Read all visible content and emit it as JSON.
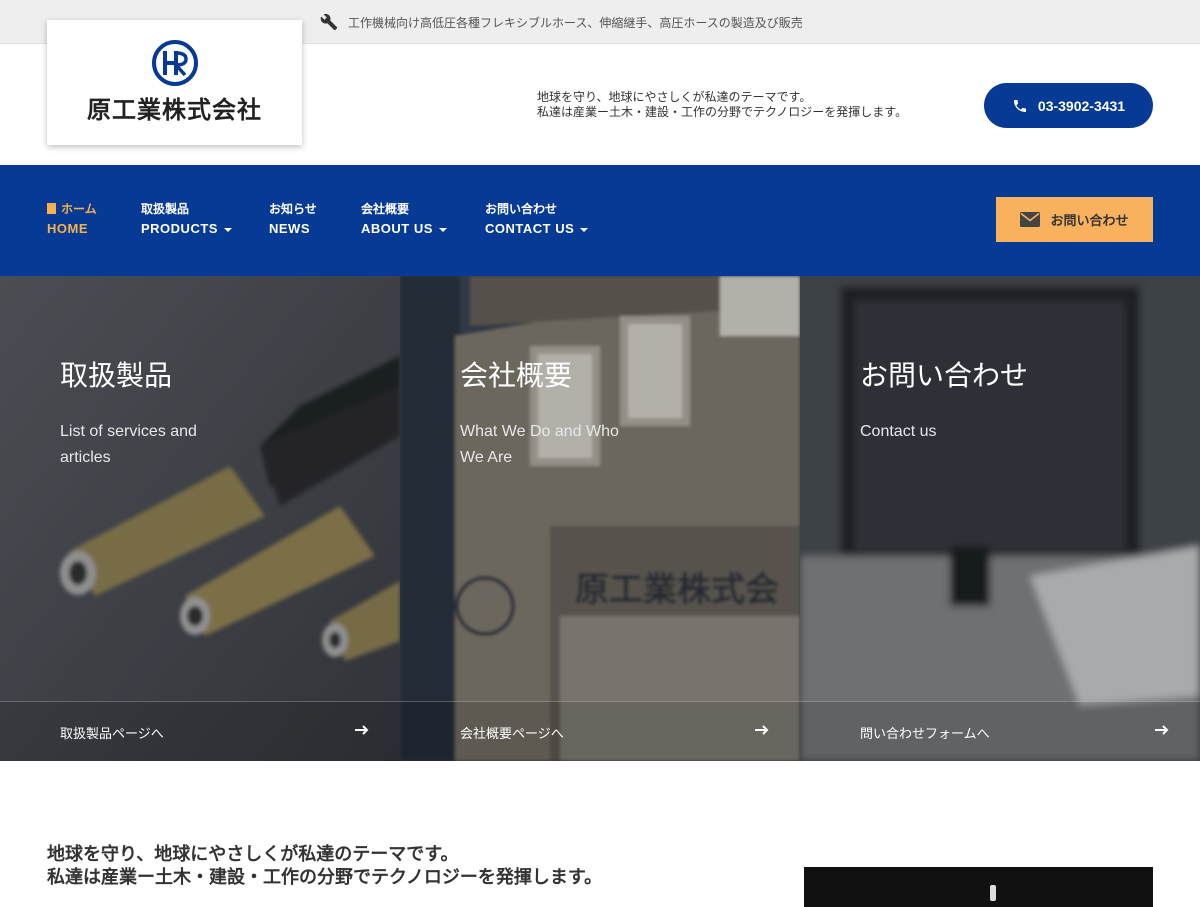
{
  "topbar": {
    "text": "工作機械向け高低圧各種フレキシブルホース、伸縮継手、高圧ホースの製造及び販売",
    "icon": "wrench-icon"
  },
  "header": {
    "logo_name": "原工業株式会社",
    "tagline_1": "地球を守り、地球にやさしくが私達のテーマです。",
    "tagline_2": "私達は産業ー土木・建設・工作の分野でテクノロジーを発揮します。",
    "phone": "03-3902-3431"
  },
  "nav": {
    "items": [
      {
        "jp": "ホーム",
        "en": "HOME",
        "active": true
      },
      {
        "jp": "取扱製品",
        "en": "PRODUCTS",
        "dropdown": true
      },
      {
        "jp": "お知らせ",
        "en": "NEWS"
      },
      {
        "jp": "会社概要",
        "en": "ABOUT US",
        "dropdown": true
      },
      {
        "jp": "お問い合わせ",
        "en": "CONTACT US",
        "dropdown": true
      }
    ],
    "contact_button": "お問い合わせ"
  },
  "panels": [
    {
      "title": "取扱製品",
      "subtitle": "List of services and articles",
      "link": "取扱製品ページへ"
    },
    {
      "title": "会社概要",
      "subtitle": "What We Do and Who We Are",
      "link": "会社概要ページへ"
    },
    {
      "title": "お問い合わせ",
      "subtitle": "Contact us",
      "link": "問い合わせフォームへ"
    }
  ],
  "intro": {
    "line_1": "地球を守り、地球にやさしくが私達のテーマです。",
    "line_2": "私達は産業ー土木・建設・工作の分野でテクノロジーを発揮します。"
  },
  "colors": {
    "brand_blue": "#063a95",
    "accent_orange": "#f8b25e",
    "active_nav": "#f5b24f"
  }
}
